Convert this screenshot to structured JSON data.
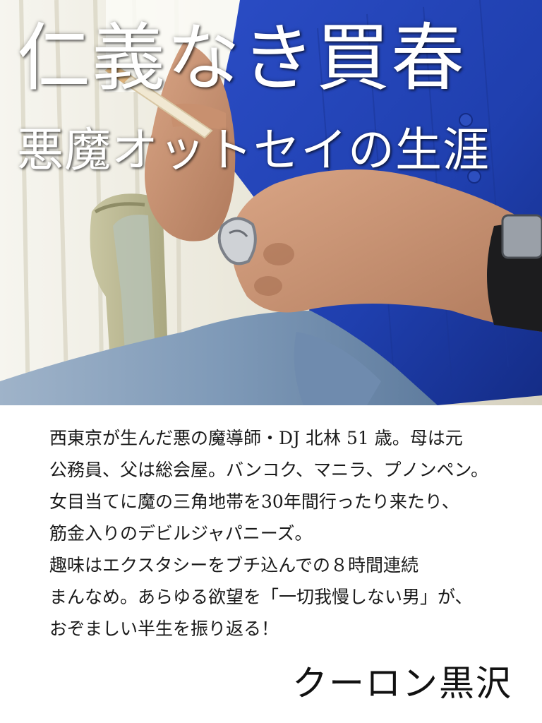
{
  "cover": {
    "title": "仁義なき買春",
    "subtitle": "悪魔オットセイの生涯",
    "description_lines": [
      "西東京が生んだ悪の魔導師・DJ 北林 51 歳。母は元",
      "公務員、父は総会屋。バンコク、マニラ、プノンペン。",
      "女目当てに魔の三角地帯を30年間行ったり来たり、",
      "筋金入りのデビルジャパニーズ。",
      "趣味はエクスタシーをブチ込んでの８時間連続",
      "まんなめ。あらゆる欲望を「一切我慢しない男」が、",
      "おぞましい半生を振り返る！"
    ],
    "author": "クーロン黒沢"
  },
  "colors": {
    "shirt": "#1f3fae",
    "jeans": "#7f9ab8",
    "curtain": "#efeee6",
    "text": "#1a1a1a",
    "title_text": "#ffffff"
  }
}
